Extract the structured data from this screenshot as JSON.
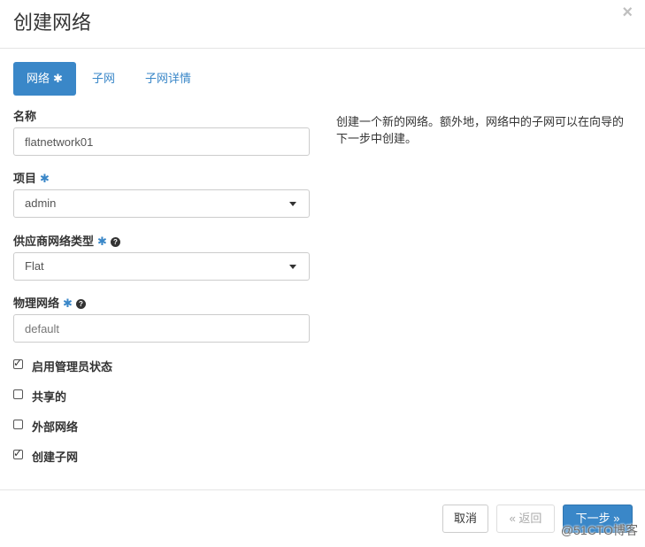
{
  "dialog": {
    "title": "创建网络",
    "close_glyph": "×"
  },
  "tabs": [
    {
      "label": "网络",
      "required": "✱"
    },
    {
      "label": "子网"
    },
    {
      "label": "子网详情"
    }
  ],
  "form": {
    "name": {
      "label": "名称",
      "value": "flatnetwork01"
    },
    "project": {
      "label": "项目",
      "required": "✱",
      "value": "admin"
    },
    "provider_type": {
      "label": "供应商网络类型",
      "required": "✱",
      "help": "?",
      "value": "Flat"
    },
    "physical_network": {
      "label": "物理网络",
      "required": "✱",
      "help": "?",
      "placeholder": "default"
    },
    "checkboxes": [
      {
        "label": "启用管理员状态",
        "checked": true
      },
      {
        "label": "共享的",
        "checked": false
      },
      {
        "label": "外部网络",
        "checked": false
      },
      {
        "label": "创建子网",
        "checked": true
      }
    ]
  },
  "description": "创建一个新的网络。额外地，网络中的子网可以在向导的下一步中创建。",
  "footer": {
    "cancel": "取消",
    "back": "« 返回",
    "next": "下一步 »"
  },
  "watermark": "@51CTO博客",
  "colors": {
    "accent": "#3a87c8",
    "border": "#cccccc"
  }
}
